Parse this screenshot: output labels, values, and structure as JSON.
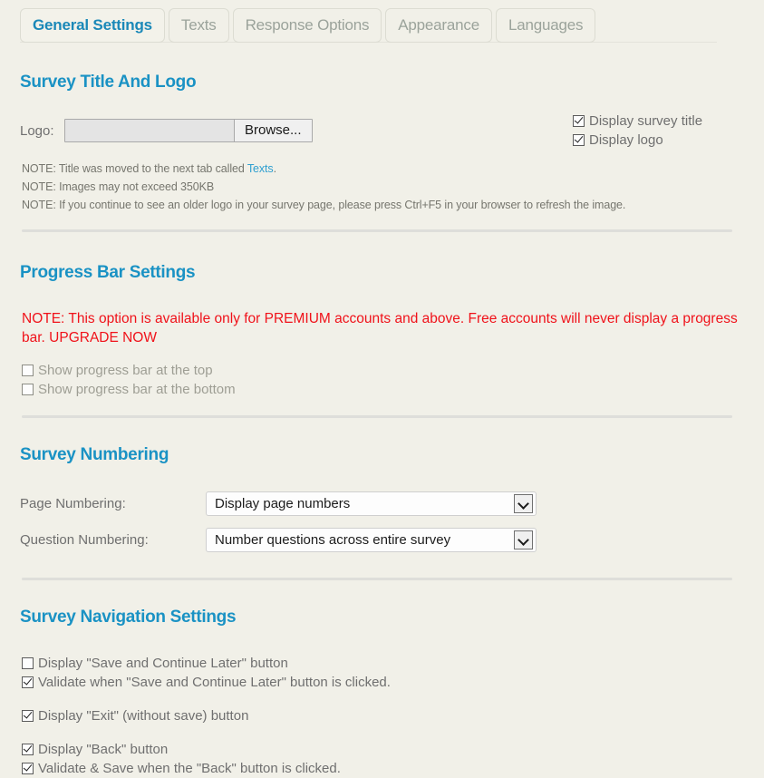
{
  "tabs": [
    {
      "label": "General Settings",
      "active": true
    },
    {
      "label": "Texts",
      "active": false
    },
    {
      "label": "Response Options",
      "active": false
    },
    {
      "label": "Appearance",
      "active": false
    },
    {
      "label": "Languages",
      "active": false
    }
  ],
  "colors": {
    "page_background": "#f1f0e8",
    "section_heading": "#1a92c4",
    "active_tab_text": "#1a88b8",
    "inactive_tab_text": "#9ba39b",
    "warning_red": "#f0121a",
    "link_blue": "#2f9fd0",
    "divider": "#dededa"
  },
  "survey_title_and_logo": {
    "heading": "Survey Title And Logo",
    "logo_label": "Logo:",
    "logo_input_value": "",
    "browse_button": "Browse...",
    "checkboxes": [
      {
        "label": "Display survey title",
        "checked": true
      },
      {
        "label": "Display logo",
        "checked": true
      }
    ],
    "notes": [
      {
        "prefix": "NOTE: Title was moved to the next tab called ",
        "link": "Texts",
        "suffix": "."
      },
      {
        "prefix": "NOTE: Images may not exceed 350KB",
        "link": "",
        "suffix": ""
      },
      {
        "prefix": "NOTE: If you continue to see an older logo in your survey page, please press Ctrl+F5 in your browser to refresh the image.",
        "link": "",
        "suffix": ""
      }
    ]
  },
  "progress_bar_settings": {
    "heading": "Progress Bar Settings",
    "warning": "NOTE: This option is available only for PREMIUM accounts and above. Free accounts will never display a progress bar. UPGRADE NOW",
    "checkboxes": [
      {
        "label": "Show progress bar at the top",
        "checked": false
      },
      {
        "label": "Show progress bar at the bottom",
        "checked": false
      }
    ]
  },
  "survey_numbering": {
    "heading": "Survey Numbering",
    "page_numbering": {
      "label": "Page Numbering:",
      "value": "Display page numbers"
    },
    "question_numbering": {
      "label": "Question Numbering:",
      "value": "Number questions across entire survey"
    }
  },
  "survey_navigation_settings": {
    "heading": "Survey Navigation Settings",
    "group_one": [
      {
        "label": "Display \"Save and Continue Later\" button",
        "checked": false
      },
      {
        "label": "Validate when \"Save and Continue Later\" button is clicked.",
        "checked": true
      }
    ],
    "group_two": [
      {
        "label": "Display \"Exit\" (without save) button",
        "checked": true
      }
    ],
    "group_three": [
      {
        "label": "Display \"Back\" button",
        "checked": true
      },
      {
        "label": "Validate & Save when the \"Back\" button is clicked.",
        "checked": true
      }
    ]
  }
}
